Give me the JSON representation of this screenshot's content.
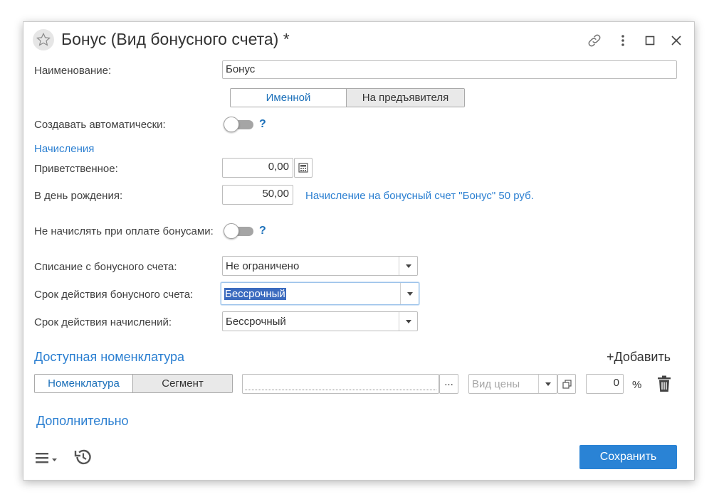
{
  "window": {
    "title": "Бонус (Вид бонусного счета) *"
  },
  "form": {
    "name_label": "Наименование:",
    "name_value": "Бонус",
    "type_options": [
      "Именной",
      "На предъявителя"
    ],
    "auto_create_label": "Создавать автоматически:",
    "help_mark": "?",
    "accruals_header": "Начисления",
    "welcome_label": "Приветственное:",
    "welcome_value": "0,00",
    "birthday_label": "В день рождения:",
    "birthday_value": "50,00",
    "birthday_hint": "Начисление на бонусный счет \"Бонус\" 50 руб.",
    "no_accrual_label": "Не начислять при оплате бонусами:",
    "writeoff_label": "Списание с бонусного счета:",
    "writeoff_value": "Не ограничено",
    "account_validity_label": "Срок действия бонусного счета:",
    "account_validity_value": "Бессрочный",
    "accrual_validity_label": "Срок действия начислений:",
    "accrual_validity_value": "Бессрочный"
  },
  "nomenclature": {
    "title": "Доступная номенклатура",
    "add_label": "+Добавить",
    "tabs": [
      "Номенклатура",
      "Сегмент"
    ],
    "ellipsis": "...",
    "price_type_placeholder": "Вид цены",
    "percent_value": "0",
    "percent_sign": "%"
  },
  "additional": {
    "label": "Дополнительно"
  },
  "footer": {
    "save_label": "Сохранить"
  },
  "colors": {
    "accent": "#2b7fd1",
    "save_button": "#2a83d5",
    "selection": "#3b6bbf"
  }
}
